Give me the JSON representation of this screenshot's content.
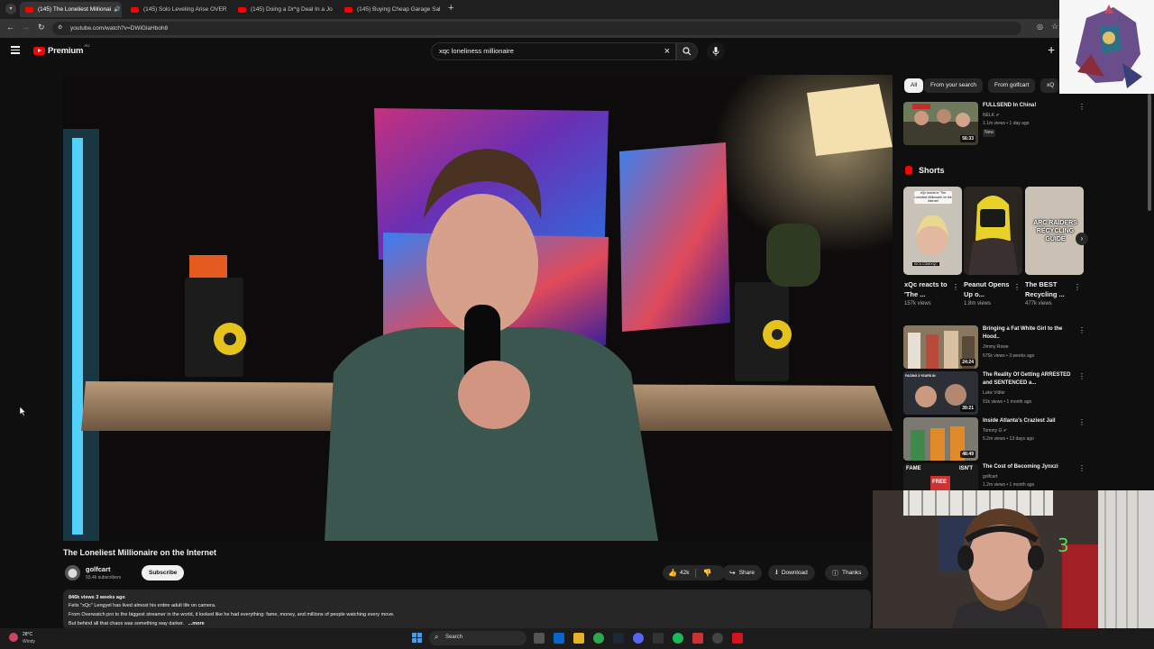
{
  "browser": {
    "tabs": [
      {
        "label": "(145) The Loneliest Millionai",
        "active": true
      },
      {
        "label": "(145) Solo Leveling Arise OVER",
        "active": false
      },
      {
        "label": "(145) Doing a Dr*g Deal In a Jo",
        "active": false
      },
      {
        "label": "(145) Buying Cheap Garage Sal",
        "active": false
      }
    ],
    "url": "youtube.com/watch?v=DWiGlaHboh8"
  },
  "youtube": {
    "brand": "Premium",
    "region": "AU",
    "search_value": "xqc loneliness millionaire"
  },
  "video": {
    "title": "The Loneliest Millionaire on the Internet",
    "channel": "golfcart",
    "subscribers": "93.4k subscribers",
    "subscribe_label": "Subscribe",
    "likes": "42k",
    "share_label": "Share",
    "download_label": "Download",
    "thanks_label": "Thanks",
    "views_date": "846k views  3 weeks ago",
    "desc_line1": "Felix \"xQc\" Lengyel has lived almost his entire adult life on camera.",
    "desc_line2": "From Overwatch pro to the biggest streamer in the world, it looked like he had everything: fame, money, and millions of people watching every move.",
    "desc_line3": "But behind all that chaos was something way darker.",
    "more_label": "...more"
  },
  "filters": [
    "All",
    "From your search",
    "From golfcart",
    "xQ"
  ],
  "recommended_top": {
    "title": "FULLSEND In China!",
    "channel": "NELK",
    "meta": "1.1m views • 1 day ago",
    "badge": "New",
    "duration": "56:33"
  },
  "shorts_heading": "Shorts",
  "shorts": [
    {
      "title": "xQc reacts to 'The ...",
      "views": "157k views"
    },
    {
      "title": "Peanut Opens Up o...",
      "views": "1.8m views"
    },
    {
      "title": "The BEST Recycling ...",
      "views": "477k views"
    }
  ],
  "shorts_overlay": {
    "thumb1_caption": "xQc reacts to 'The Loneliest Millionaire on the Internet'",
    "thumb1_footer": "KICK.COM/XQC",
    "thumb3_caption": "ARC RAIDERS RECYCLING GUIDE"
  },
  "recommended": [
    {
      "title": "Bringing a Fat White Girl to the Hood..",
      "channel": "Jimmy Rowe",
      "meta": "675k views • 3 weeks ago",
      "duration": "24:24"
    },
    {
      "title": "The Reality Of Getting ARRESTED and SENTENCED a...",
      "channel": "Luke Vidler",
      "meta": "91k views • 1 month ago",
      "duration": "39:21"
    },
    {
      "title": "Inside Atlanta's Craziest Jail",
      "channel": "Tommy G",
      "meta": "5.2m views • 13 days ago",
      "duration": "48:49"
    },
    {
      "title": "The Cost of Becoming Jynxzi",
      "channel": "golfcart",
      "meta": "1.2m views • 1 month ago",
      "duration": ""
    }
  ],
  "thumb_overlay": {
    "rv2_caption": "FACING 3 YEARS IN",
    "rv4_caption_left": "FAME",
    "rv4_caption_right": "ISN'T",
    "rv4_caption_bottom": "FREE"
  },
  "taskbar": {
    "weather_temp": "28°C",
    "weather_label": "Windy",
    "search_label": "Search"
  },
  "colors": {
    "yt_red": "#ff0000",
    "background": "#0f0f0f",
    "chip_bg": "#272727"
  }
}
